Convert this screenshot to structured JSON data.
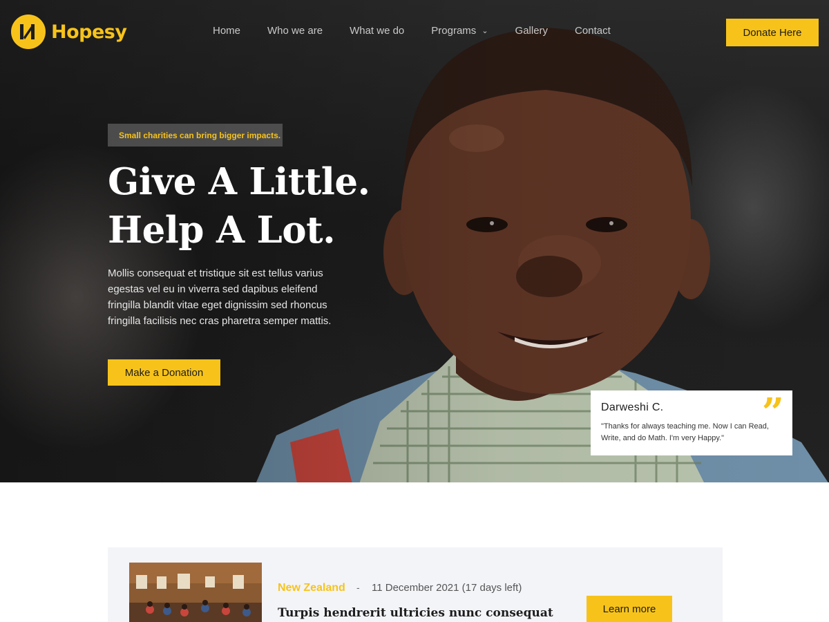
{
  "brand": {
    "name": "Hopesy",
    "accent": "#f7c31b"
  },
  "nav": {
    "items": [
      {
        "label": "Home"
      },
      {
        "label": "Who we are"
      },
      {
        "label": "What we do"
      },
      {
        "label": "Programs",
        "has_dropdown": true
      },
      {
        "label": "Gallery"
      },
      {
        "label": "Contact"
      }
    ],
    "cta_label": "Donate Here"
  },
  "hero": {
    "tagline": "Small charities can bring bigger impacts.",
    "headline_line1": "Give A Little.",
    "headline_line2": "Help A Lot.",
    "description": "Mollis consequat et tristique sit est tellus varius egestas vel eu in viverra sed dapibus eleifend fringilla blandit vitae eget dignissim sed rhoncus fringilla facilisis nec cras pharetra semper mattis.",
    "cta_label": "Make a Donation"
  },
  "testimonial": {
    "name": "Darweshi C.",
    "quote": "\"Thanks for always teaching me. Now I can Read, Write, and do Math. I'm very Happy.\"",
    "icon": "quote-icon"
  },
  "campaign": {
    "location": "New Zealand",
    "separator": "-",
    "date": "11 December 2021 (17 days left)",
    "title": "Turpis hendrerit ultricies nunc consequat",
    "cta_label": "Learn more"
  }
}
